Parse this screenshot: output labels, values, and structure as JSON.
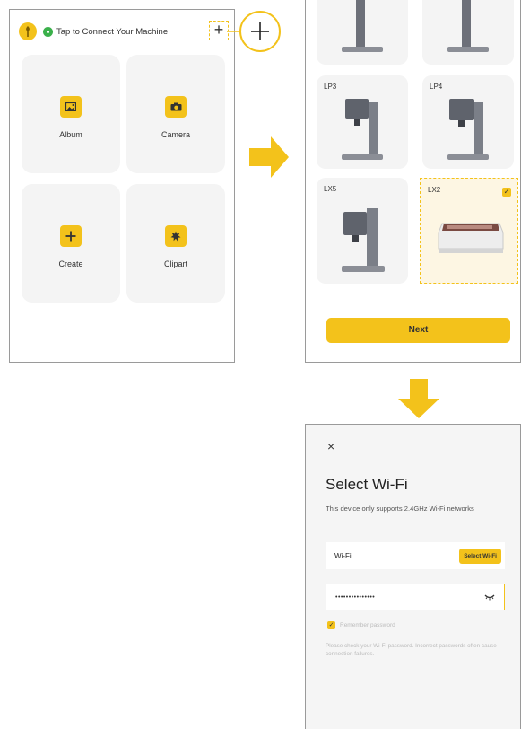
{
  "screen1": {
    "connect_text": "Tap to Connect Your Machine",
    "plus_symbol": "+",
    "tiles": [
      {
        "label": "Album",
        "icon": "image-icon"
      },
      {
        "label": "Camera",
        "icon": "camera-icon"
      },
      {
        "label": "Create",
        "icon": "plus-icon"
      },
      {
        "label": "Clipart",
        "icon": "clipart-icon"
      }
    ]
  },
  "screen2": {
    "machines": [
      {
        "label": "LP3",
        "selected": false
      },
      {
        "label": "LP4",
        "selected": false
      },
      {
        "label": "LX5",
        "selected": false
      },
      {
        "label": "LX2",
        "selected": true
      }
    ],
    "check_mark": "✓",
    "next_label": "Next"
  },
  "screen3": {
    "close_symbol": "×",
    "title": "Select Wi-Fi",
    "subtitle": "This device only supports 2.4GHz Wi-Fi networks",
    "wifi_label": "Wi-Fi",
    "select_button": "Select Wi-Fi",
    "password_value": "•••••••••••••••",
    "remember_label": "Remember password",
    "hint": "Please check your Wi-Fi password. Incorrect passwords often cause connection failures."
  },
  "colors": {
    "accent": "#f3c21b",
    "tile_bg": "#f4f4f4",
    "connected": "#3ab04a"
  }
}
